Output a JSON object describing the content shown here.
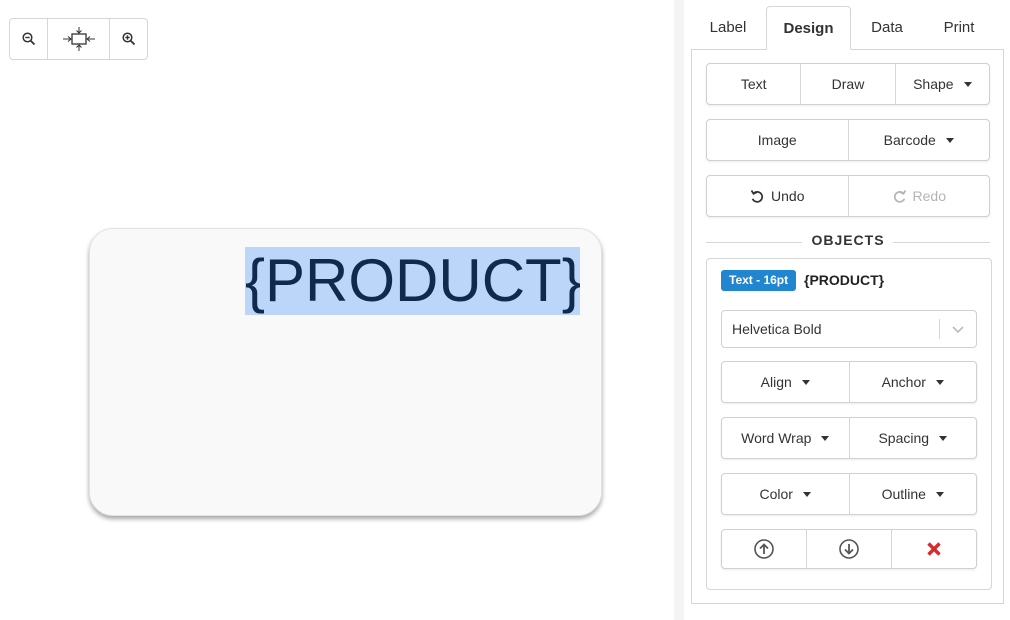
{
  "zoom": {
    "zoom_out_icon": "zoom-out-icon",
    "fit_icon": "fit-to-screen-icon",
    "zoom_in_icon": "zoom-in-icon"
  },
  "label": {
    "text": "{PRODUCT}",
    "highlight_color": "#bcd6fa"
  },
  "tabs": [
    {
      "label": "Label",
      "active": false
    },
    {
      "label": "Design",
      "active": true
    },
    {
      "label": "Data",
      "active": false
    },
    {
      "label": "Print",
      "active": false
    }
  ],
  "tools": {
    "text": "Text",
    "draw": "Draw",
    "shape": "Shape",
    "image": "Image",
    "barcode": "Barcode",
    "undo": "Undo",
    "redo": "Redo"
  },
  "objects": {
    "title": "OBJECTS",
    "selected": {
      "badge": "Text - 16pt",
      "name": "{PRODUCT}",
      "font": "Helvetica Bold"
    },
    "buttons": {
      "align": "Align",
      "anchor": "Anchor",
      "word_wrap": "Word Wrap",
      "spacing": "Spacing",
      "color": "Color",
      "outline": "Outline"
    }
  },
  "colors": {
    "accent": "#2185d0",
    "delete": "#db2828"
  }
}
